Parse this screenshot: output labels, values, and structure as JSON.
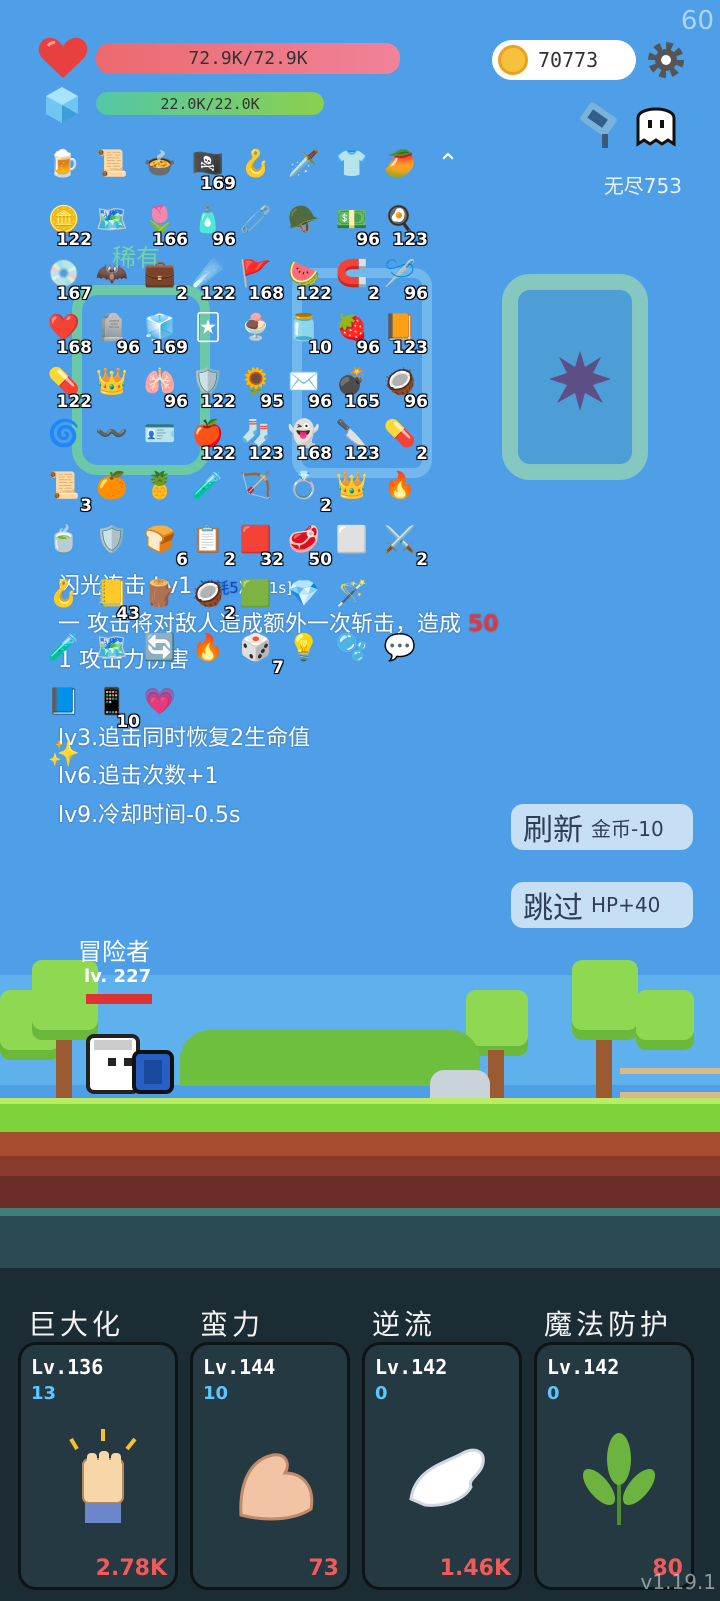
{
  "fps": "60",
  "hud": {
    "hp_text": "72.9K/72.9K",
    "mp_text": "22.0K/22.0K",
    "coins": "70773",
    "endless_label": "无尽753"
  },
  "rarity_label": "稀有",
  "items": [
    {
      "icon": "🍺",
      "count": ""
    },
    {
      "icon": "📜",
      "count": ""
    },
    {
      "icon": "🍲",
      "count": ""
    },
    {
      "icon": "🏴‍☠️",
      "count": "169"
    },
    {
      "icon": "🪝",
      "count": ""
    },
    {
      "icon": "🗡️",
      "count": ""
    },
    {
      "icon": "👕",
      "count": ""
    },
    {
      "icon": "🥭",
      "count": ""
    },
    {
      "icon": "⌃",
      "count": ""
    },
    {
      "icon": "🪙",
      "count": "122"
    },
    {
      "icon": "🗺️",
      "count": ""
    },
    {
      "icon": "🌷",
      "count": "166"
    },
    {
      "icon": "🧴",
      "count": "96"
    },
    {
      "icon": "🧷",
      "count": ""
    },
    {
      "icon": "🪖",
      "count": ""
    },
    {
      "icon": "💵",
      "count": "96"
    },
    {
      "icon": "🍳",
      "count": "123"
    },
    {
      "icon": "💿",
      "count": "167"
    },
    {
      "icon": "🦇",
      "count": ""
    },
    {
      "icon": "💼",
      "count": "2"
    },
    {
      "icon": "☄️",
      "count": "122"
    },
    {
      "icon": "🚩",
      "count": "168"
    },
    {
      "icon": "🍉",
      "count": "122"
    },
    {
      "icon": "🧲",
      "count": "2"
    },
    {
      "icon": "🪡",
      "count": "96"
    },
    {
      "icon": "❤️",
      "count": "168"
    },
    {
      "icon": "🪦",
      "count": "96"
    },
    {
      "icon": "🧊",
      "count": "169"
    },
    {
      "icon": "🃏",
      "count": ""
    },
    {
      "icon": "🍨",
      "count": ""
    },
    {
      "icon": "🫙",
      "count": "10"
    },
    {
      "icon": "🍓",
      "count": "96"
    },
    {
      "icon": "📙",
      "count": "123"
    },
    {
      "icon": "💊",
      "count": "122"
    },
    {
      "icon": "👑",
      "count": ""
    },
    {
      "icon": "🫁",
      "count": "96"
    },
    {
      "icon": "🛡️",
      "count": "122"
    },
    {
      "icon": "🌻",
      "count": "95"
    },
    {
      "icon": "✉️",
      "count": "96"
    },
    {
      "icon": "💣",
      "count": "165"
    },
    {
      "icon": "🥥",
      "count": "96"
    },
    {
      "icon": "🌀",
      "count": ""
    },
    {
      "icon": "〰️",
      "count": ""
    },
    {
      "icon": "🪪",
      "count": ""
    },
    {
      "icon": "🍎",
      "count": "122"
    },
    {
      "icon": "🧦",
      "count": "123"
    },
    {
      "icon": "👻",
      "count": "168"
    },
    {
      "icon": "🔪",
      "count": "123"
    },
    {
      "icon": "💊",
      "count": "2"
    },
    {
      "icon": "📜",
      "count": "3"
    },
    {
      "icon": "🍊",
      "count": ""
    },
    {
      "icon": "🍍",
      "count": ""
    },
    {
      "icon": "🧪",
      "count": ""
    },
    {
      "icon": "🏹",
      "count": ""
    },
    {
      "icon": "💍",
      "count": "2"
    },
    {
      "icon": "👑",
      "count": ""
    },
    {
      "icon": "🔥",
      "count": ""
    },
    {
      "icon": "🍵",
      "count": ""
    },
    {
      "icon": "🛡️",
      "count": ""
    },
    {
      "icon": "🍞",
      "count": "6"
    },
    {
      "icon": "📋",
      "count": "2"
    },
    {
      "icon": "🟥",
      "count": "32"
    },
    {
      "icon": "🥩",
      "count": "50"
    },
    {
      "icon": "⬜",
      "count": ""
    },
    {
      "icon": "⚔️",
      "count": "2"
    },
    {
      "icon": "🪝",
      "count": ""
    },
    {
      "icon": "📒",
      "count": "43"
    },
    {
      "icon": "🪵",
      "count": ""
    },
    {
      "icon": "🥥",
      "count": "2"
    },
    {
      "icon": "🟩",
      "count": ""
    },
    {
      "icon": "💎",
      "count": ""
    },
    {
      "icon": "🪄",
      "count": ""
    },
    {
      "icon": "🧪",
      "count": ""
    },
    {
      "icon": "🗺️",
      "count": ""
    },
    {
      "icon": "🔄",
      "count": ""
    },
    {
      "icon": "🔥",
      "count": ""
    },
    {
      "icon": "🎲",
      "count": "7"
    },
    {
      "icon": "💡",
      "count": ""
    },
    {
      "icon": "🫧",
      "count": ""
    },
    {
      "icon": "💬",
      "count": ""
    },
    {
      "icon": "📘",
      "count": ""
    },
    {
      "icon": "📱",
      "count": "10"
    },
    {
      "icon": "💗",
      "count": ""
    },
    {
      "icon": "✨",
      "count": ""
    }
  ],
  "skill": {
    "title": "闪光连击 Lv1",
    "cost": "消耗5",
    "cooldown": "冷却1s]:",
    "desc1_prefix": "一 攻击将对敌人造成额外一次斩击，造成",
    "desc1_value": "50",
    "desc2": "1 攻击力伤害",
    "lv3": "lv3.追击同时恢复2生命值",
    "lv6": "lv6.追击次数+1",
    "lv9": "lv9.冷却时间-0.5s"
  },
  "buttons": {
    "refresh_label": "刷新",
    "refresh_cost": "金币-10",
    "skip_label": "跳过",
    "skip_reward": "HP+40"
  },
  "adventurer": {
    "name": "冒险者",
    "level": "lv. 227"
  },
  "cards": [
    {
      "name": "巨大化",
      "level": "Lv.136",
      "points": "13",
      "cost": "2.78K",
      "icon": "fist-icon"
    },
    {
      "name": "蛮力",
      "level": "Lv.144",
      "points": "10",
      "cost": "73",
      "icon": "muscle-icon"
    },
    {
      "name": "逆流",
      "level": "Lv.142",
      "points": "0",
      "cost": "1.46K",
      "icon": "wing-icon"
    },
    {
      "name": "魔法防护",
      "level": "Lv.142",
      "points": "0",
      "cost": "80",
      "icon": "leaf-icon"
    }
  ],
  "version": "v1.19.1"
}
